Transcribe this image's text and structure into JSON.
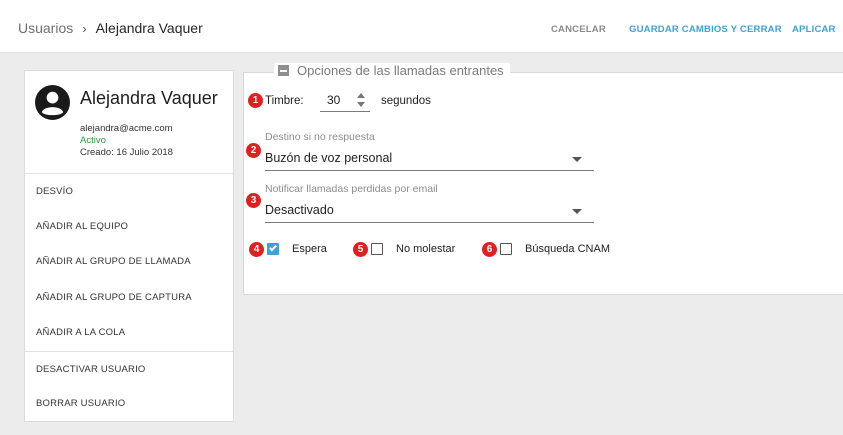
{
  "breadcrumb": {
    "root": "Usuarios",
    "separator": "›",
    "current": "Alejandra Vaquer"
  },
  "actions": {
    "cancel": "CANCELAR",
    "save_close": "GUARDAR CAMBIOS Y CERRAR",
    "apply": "APLICAR"
  },
  "user": {
    "name": "Alejandra Vaquer",
    "email": "alejandra@acme.com",
    "status": "Activo",
    "created": "Creado: 16 Julio 2018",
    "avatar_icon": "account-circle-icon"
  },
  "menu": {
    "items": [
      {
        "label": "DESVÍO"
      },
      {
        "label": "AÑADIR AL EQUIPO"
      },
      {
        "label": "AÑADIR AL GRUPO DE LLAMADA"
      },
      {
        "label": "AÑADIR AL GRUPO DE CAPTURA"
      },
      {
        "label": "AÑADIR A LA COLA"
      },
      {
        "label": "DESACTIVAR USUARIO"
      },
      {
        "label": "BORRAR USUARIO"
      }
    ]
  },
  "section": {
    "title": "Opciones de las llamadas entrantes",
    "collapse_icon": "minus-square-icon"
  },
  "badges": [
    "1",
    "2",
    "3",
    "4",
    "5",
    "6"
  ],
  "ring": {
    "label": "Timbre:",
    "value": "30",
    "unit": "segundos"
  },
  "no_answer": {
    "label": "Destino si no respuesta",
    "value": "Buzón de voz personal"
  },
  "missed_email": {
    "label": "Notificar llamadas perdidas por email",
    "value": "Desactivado"
  },
  "checkboxes": {
    "hold": {
      "label": "Espera",
      "checked": true
    },
    "dnd": {
      "label": "No molestar",
      "checked": false
    },
    "cnam": {
      "label": "Búsqueda CNAM",
      "checked": false
    }
  },
  "colors": {
    "accent": "#3ba3d6",
    "badge": "#e02020",
    "active": "#2f9a3a"
  }
}
